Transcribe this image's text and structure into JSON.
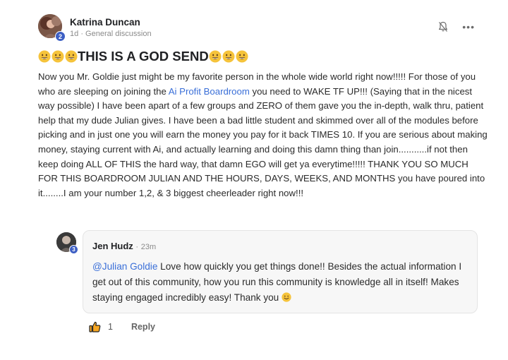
{
  "post": {
    "author": "Katrina Duncan",
    "level": "2",
    "time": "1d",
    "separator": "·",
    "category": "General discussion",
    "title_text": "THIS IS A GOD SEND",
    "title_emoji": "grinning-face-emoji",
    "body_part1": "Now you Mr. Goldie just might be my favorite person in the whole wide world right now!!!!! For those of you who are sleeping on joining the ",
    "body_link": "Ai Profit Boardroom",
    "body_part2": " you need to WAKE TF UP!!! (Saying that in the nicest way possible) I have been apart of a few groups and ZERO of them gave you the in-depth, walk thru, patient help that my dude Julian gives. I have been a bad little student and skimmed over all of the modules before picking and in just one you will earn the money you pay for it back TIMES 10. If you are serious about making money, staying current with Ai, and actually learning and doing this damn thing than join...........if not then keep doing ALL OF THIS the hard way, that damn EGO will get ya everytime!!!!! THANK YOU SO MUCH FOR THIS BOARDROOM JULIAN AND THE HOURS, DAYS, WEEKS, AND MONTHS you have poured into it........I am your number 1,2, & 3 biggest cheerleader right now!!!",
    "icons": {
      "notify": "bell-off-icon",
      "more": "more-horizontal-icon"
    },
    "more_glyph": "•••"
  },
  "comment": {
    "author": "Jen Hudz",
    "level": "3",
    "separator": "·",
    "time": "23m",
    "mention": "@Julian Goldie",
    "text": " Love how quickly you get things done!! Besides the actual information I get out of this community, how you run this community is knowledge all in itself! Makes staying engaged incredibly easy! Thank you ",
    "like_count": "1",
    "reply_label": "Reply"
  },
  "colors": {
    "link": "#3a6fd8",
    "badge": "#3d5fc4",
    "emoji": "#f5c33b"
  }
}
